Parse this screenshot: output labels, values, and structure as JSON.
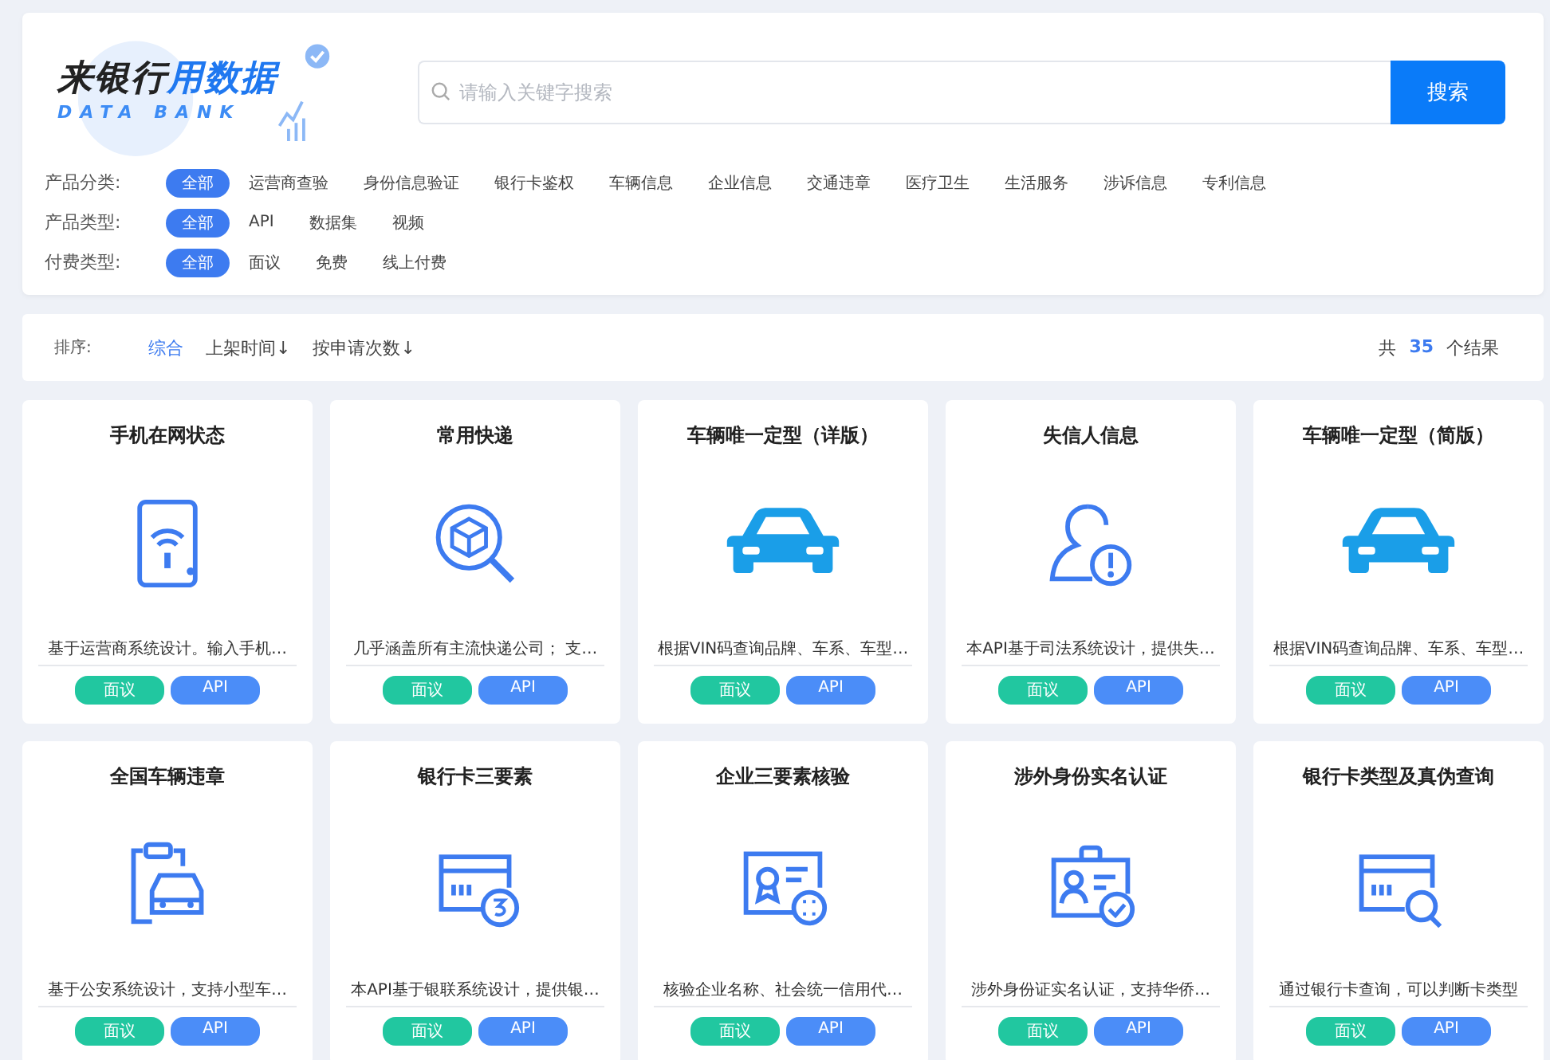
{
  "logo": {
    "title_dark": "来银行",
    "title_blue": "用数据",
    "subtitle": "DATA BANK"
  },
  "search": {
    "placeholder": "请输入关键字搜索",
    "button": "搜索"
  },
  "filters": [
    {
      "label": "产品分类:",
      "options": [
        {
          "text": "全部",
          "selected": true
        },
        {
          "text": "运营商查验",
          "selected": false
        },
        {
          "text": "身份信息验证",
          "selected": false
        },
        {
          "text": "银行卡鉴权",
          "selected": false
        },
        {
          "text": "车辆信息",
          "selected": false
        },
        {
          "text": "企业信息",
          "selected": false
        },
        {
          "text": "交通违章",
          "selected": false
        },
        {
          "text": "医疗卫生",
          "selected": false
        },
        {
          "text": "生活服务",
          "selected": false
        },
        {
          "text": "涉诉信息",
          "selected": false
        },
        {
          "text": "专利信息",
          "selected": false
        }
      ]
    },
    {
      "label": "产品类型:",
      "options": [
        {
          "text": "全部",
          "selected": true
        },
        {
          "text": "API",
          "selected": false
        },
        {
          "text": "数据集",
          "selected": false
        },
        {
          "text": "视频",
          "selected": false
        }
      ]
    },
    {
      "label": "付费类型:",
      "options": [
        {
          "text": "全部",
          "selected": true
        },
        {
          "text": "面议",
          "selected": false
        },
        {
          "text": "免费",
          "selected": false
        },
        {
          "text": "线上付费",
          "selected": false
        }
      ]
    }
  ],
  "sort": {
    "label": "排序:",
    "options": [
      {
        "text": "综合",
        "selected": true
      },
      {
        "text": "上架时间↓",
        "selected": false
      },
      {
        "text": "按申请次数↓",
        "selected": false
      }
    ],
    "result_prefix": "共",
    "result_count": "35",
    "result_suffix": "个结果"
  },
  "cards": [
    {
      "title": "手机在网状态",
      "kind": "phone",
      "desc": "基于运营商系统设计。输入手机…",
      "tags": [
        {
          "text": "面议",
          "color": "#21c7a0"
        },
        {
          "text": "API",
          "color": "#4b8df8"
        }
      ]
    },
    {
      "title": "常用快递",
      "kind": "parcel",
      "desc": "几乎涵盖所有主流快递公司； 支…",
      "tags": [
        {
          "text": "面议",
          "color": "#21c7a0"
        },
        {
          "text": "API",
          "color": "#4b8df8"
        }
      ]
    },
    {
      "title": "车辆唯一定型（详版）",
      "kind": "car",
      "desc": "根据VIN码查询品牌、车系、车型…",
      "tags": [
        {
          "text": "面议",
          "color": "#21c7a0"
        },
        {
          "text": "API",
          "color": "#4b8df8"
        }
      ]
    },
    {
      "title": "失信人信息",
      "kind": "person",
      "desc": "本API基于司法系统设计，提供失…",
      "tags": [
        {
          "text": "面议",
          "color": "#21c7a0"
        },
        {
          "text": "API",
          "color": "#4b8df8"
        }
      ]
    },
    {
      "title": "车辆唯一定型（简版）",
      "kind": "car",
      "desc": "根据VIN码查询品牌、车系、车型…",
      "tags": [
        {
          "text": "面议",
          "color": "#21c7a0"
        },
        {
          "text": "API",
          "color": "#4b8df8"
        }
      ]
    },
    {
      "title": "全国车辆违章",
      "kind": "traffic",
      "desc": "基于公安系统设计，支持小型车…",
      "tags": [
        {
          "text": "面议",
          "color": "#21c7a0"
        },
        {
          "text": "API",
          "color": "#4b8df8"
        }
      ]
    },
    {
      "title": "银行卡三要素",
      "kind": "card3",
      "desc": "本API基于银联系统设计，提供银…",
      "tags": [
        {
          "text": "面议",
          "color": "#21c7a0"
        },
        {
          "text": "API",
          "color": "#4b8df8"
        }
      ]
    },
    {
      "title": "企业三要素核验",
      "kind": "license",
      "desc": "核验企业名称、社会统一信用代…",
      "tags": [
        {
          "text": "面议",
          "color": "#21c7a0"
        },
        {
          "text": "API",
          "color": "#4b8df8"
        }
      ]
    },
    {
      "title": "涉外身份实名认证",
      "kind": "idcard",
      "desc": "涉外身份证实名认证，支持华侨…",
      "tags": [
        {
          "text": "面议",
          "color": "#21c7a0"
        },
        {
          "text": "API",
          "color": "#4b8df8"
        }
      ]
    },
    {
      "title": "银行卡类型及真伪查询",
      "kind": "cardsearch",
      "desc": "通过银行卡查询，可以判断卡类型",
      "tags": [
        {
          "text": "面议",
          "color": "#21c7a0"
        },
        {
          "text": "API",
          "color": "#4b8df8"
        }
      ]
    }
  ]
}
